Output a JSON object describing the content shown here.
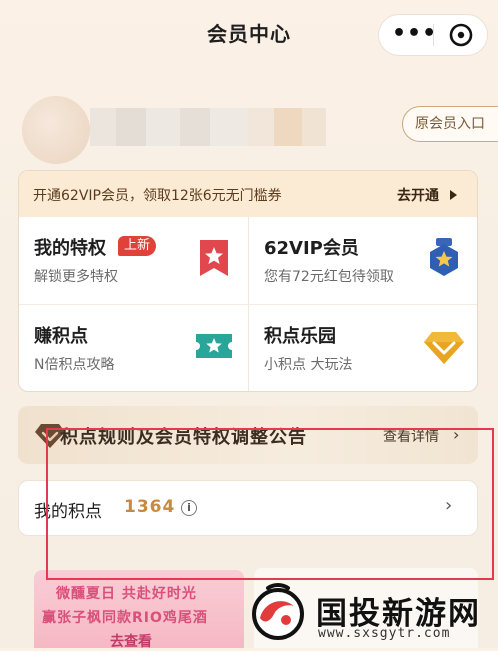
{
  "header": {
    "title": "会员中心",
    "more_label": "•••"
  },
  "profile": {
    "vip_entry_label": "原会员入口"
  },
  "privileges": {
    "banner_text": "开通62VIP会员，领取12张6元无门槛券",
    "banner_action": "去开通",
    "cells": [
      {
        "title": "我的特权",
        "badge": "上新",
        "subtitle": "解锁更多特权",
        "icon": "star-ribbon-icon"
      },
      {
        "title": "62VIP会员",
        "subtitle": "您有72元红包待领取",
        "icon": "medal-star-icon"
      },
      {
        "title": "赚积点",
        "subtitle": "N倍积点攻略",
        "icon": "ticket-star-icon"
      },
      {
        "title": "积点乐园",
        "subtitle": "小积点 大玩法",
        "icon": "diamond-icon"
      }
    ]
  },
  "announcement": {
    "text": "积点规则及会员特权调整公告",
    "action": "查看详情"
  },
  "points": {
    "label": "我的积点",
    "value": "1364"
  },
  "promo": {
    "line1": "微醺夏日 共赴好时光",
    "line2": "赢张子枫同款RIO鸡尾酒",
    "line3": "去查看"
  },
  "watermark": {
    "brand": "国投新游网",
    "url": "www.sxsgytr.com"
  },
  "colors": {
    "accent_red": "#e0423a",
    "gold": "#c78a3e",
    "highlight_border": "#e23b4e"
  }
}
